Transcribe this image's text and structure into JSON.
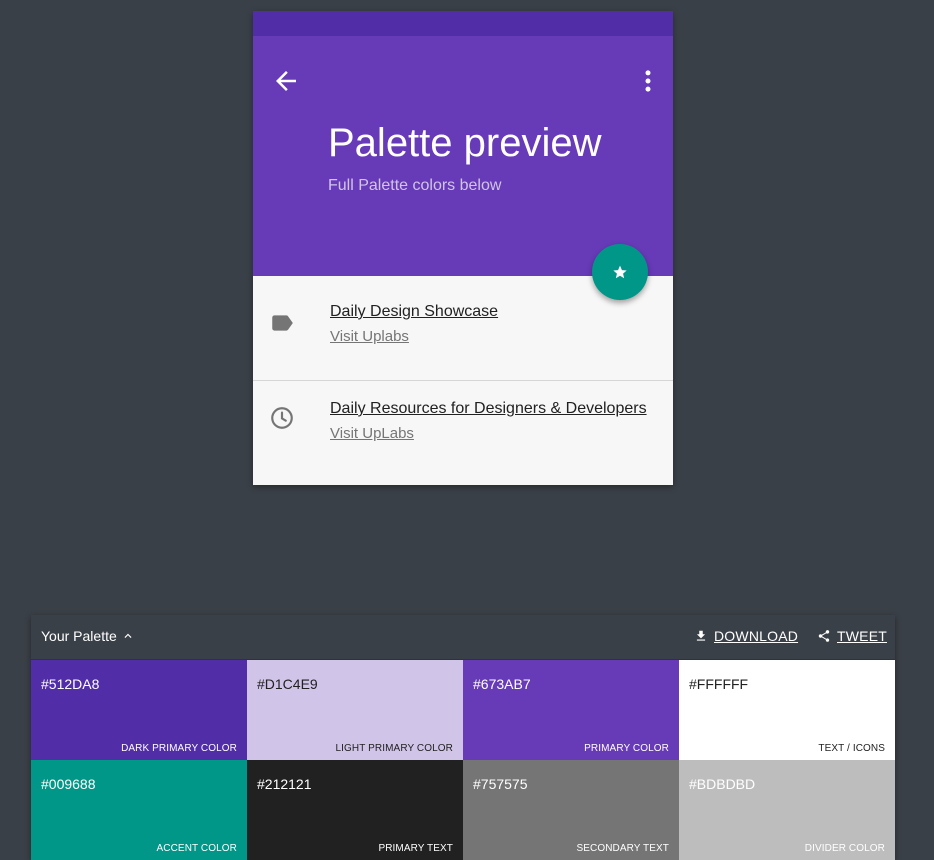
{
  "preview": {
    "title": "Palette preview",
    "subtitle": "Full Palette colors below",
    "items": [
      {
        "title": "Daily Design Showcase",
        "link": "Visit Uplabs",
        "icon": "label-icon"
      },
      {
        "title": "Daily Resources for Designers & Developers",
        "link": "Visit UpLabs",
        "icon": "clock-icon"
      }
    ]
  },
  "palette": {
    "title": "Your Palette",
    "download_label": "DOWNLOAD",
    "tweet_label": "TWEET",
    "swatches": [
      {
        "hex": "#512DA8",
        "name": "DARK PRIMARY COLOR",
        "text_color": "#ffffff"
      },
      {
        "hex": "#D1C4E9",
        "name": "LIGHT PRIMARY COLOR",
        "text_color": "#212121"
      },
      {
        "hex": "#673AB7",
        "name": "PRIMARY COLOR",
        "text_color": "#ffffff"
      },
      {
        "hex": "#FFFFFF",
        "name": "TEXT / ICONS",
        "text_color": "#212121"
      },
      {
        "hex": "#009688",
        "name": "ACCENT COLOR",
        "text_color": "#ffffff"
      },
      {
        "hex": "#212121",
        "name": "PRIMARY TEXT",
        "text_color": "#ffffff"
      },
      {
        "hex": "#757575",
        "name": "SECONDARY TEXT",
        "text_color": "#ffffff"
      },
      {
        "hex": "#BDBDBD",
        "name": "DIVIDER COLOR",
        "text_color": "#ffffff"
      }
    ]
  }
}
